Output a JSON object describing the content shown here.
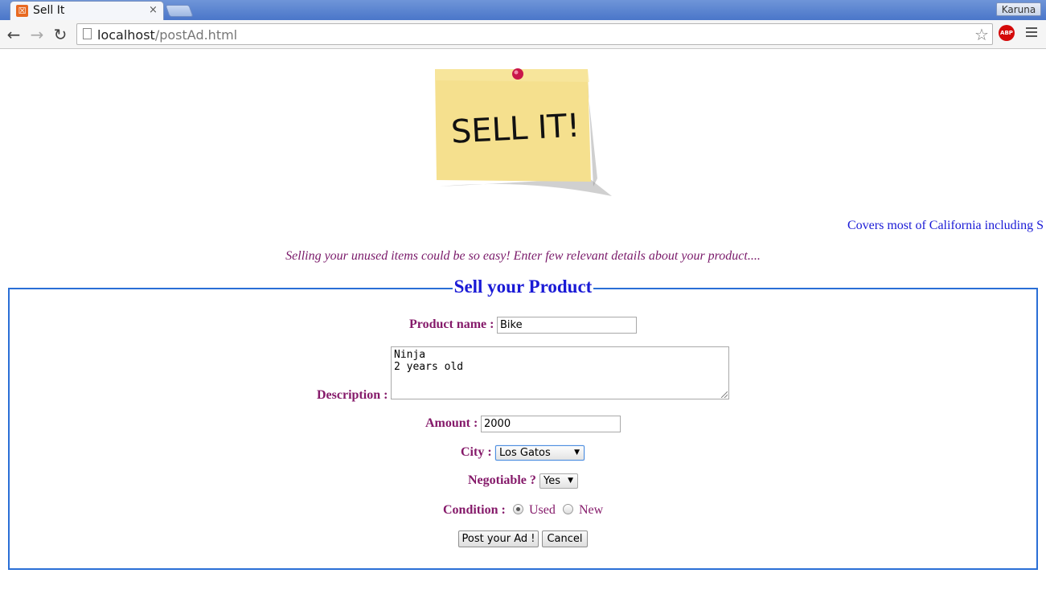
{
  "browser": {
    "tab_title": "Sell It",
    "tab_close": "×",
    "profile_name": "Karuna",
    "url_host": "localhost",
    "url_path": "/postAd.html",
    "back": "←",
    "forward": "→",
    "reload": "↻",
    "star": "☆",
    "adblock_label": "ABP",
    "favicon_glyph": "☒"
  },
  "logo": {
    "text": "SELL IT!"
  },
  "marquee": {
    "text": "Covers most of California including S"
  },
  "tagline": "Selling your unused items could be so easy! Enter few relevant details about your product....",
  "form": {
    "legend": "Sell your Product",
    "product_name_label": "Product name :",
    "product_name_value": "Bike",
    "description_label": "Description :",
    "description_value": "Ninja\n2 years old",
    "amount_label": "Amount :",
    "amount_value": "2000",
    "city_label": "City :",
    "city_value": "Los Gatos",
    "negotiable_label": "Negotiable ?",
    "negotiable_value": "Yes",
    "condition_label": "Condition :",
    "condition_options": [
      "Used",
      "New"
    ],
    "condition_selected": "Used",
    "submit_label": "Post your Ad !",
    "cancel_label": "Cancel"
  },
  "colors": {
    "label": "#851a6a",
    "legend": "#1a1ad6",
    "fieldset_border": "#2a6fd6",
    "tagline": "#7a1a6a"
  }
}
